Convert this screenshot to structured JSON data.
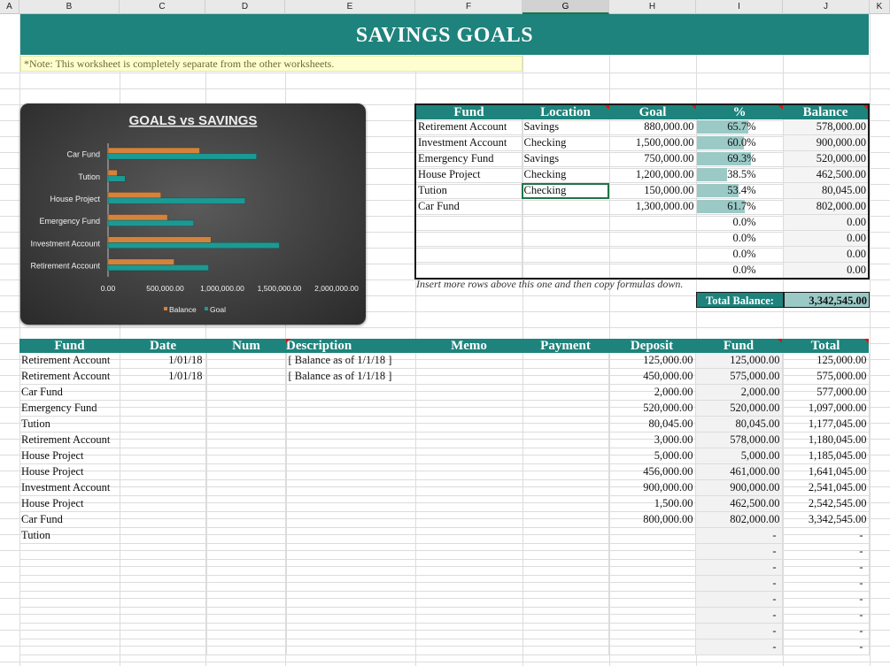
{
  "columns": [
    "A",
    "B",
    "C",
    "D",
    "E",
    "F",
    "G",
    "H",
    "I",
    "J",
    "K"
  ],
  "selected_column": "G",
  "title": "SAVINGS GOALS",
  "note": "*Note: This worksheet is completely separate from the other worksheets.",
  "chart_data": {
    "type": "bar",
    "orientation": "horizontal",
    "title": "GOALS vs SAVINGS",
    "categories": [
      "Car Fund",
      "Tution",
      "House Project",
      "Emergency Fund",
      "Investment Account",
      "Retirement Account"
    ],
    "series": [
      {
        "name": "Balance",
        "color": "#d4823c",
        "values": [
          802000,
          80045,
          462500,
          520000,
          900000,
          578000
        ]
      },
      {
        "name": "Goal",
        "color": "#1b9a93",
        "values": [
          1300000,
          150000,
          1200000,
          750000,
          1500000,
          880000
        ]
      }
    ],
    "xlim": [
      0,
      2000000
    ],
    "xticks": [
      "0.00",
      "500,000.00",
      "1,000,000.00",
      "1,500,000.00",
      "2,000,000.00"
    ],
    "legend": "bottom",
    "grid": false
  },
  "funds": {
    "headers": [
      "Fund",
      "Location",
      "Goal",
      "%",
      "Balance"
    ],
    "rows": [
      {
        "fund": "Retirement Account",
        "location": "Savings",
        "goal": "880,000.00",
        "pct": "65.7%",
        "pct_value": 0.657,
        "balance": "578,000.00"
      },
      {
        "fund": "Investment Account",
        "location": "Checking",
        "goal": "1,500,000.00",
        "pct": "60.0%",
        "pct_value": 0.6,
        "balance": "900,000.00"
      },
      {
        "fund": "Emergency Fund",
        "location": "Savings",
        "goal": "750,000.00",
        "pct": "69.3%",
        "pct_value": 0.693,
        "balance": "520,000.00"
      },
      {
        "fund": "House Project",
        "location": "Checking",
        "goal": "1,200,000.00",
        "pct": "38.5%",
        "pct_value": 0.385,
        "balance": "462,500.00"
      },
      {
        "fund": "Tution",
        "location": "Checking",
        "goal": "150,000.00",
        "pct": "53.4%",
        "pct_value": 0.534,
        "balance": "80,045.00"
      },
      {
        "fund": "Car Fund",
        "location": "",
        "goal": "1,300,000.00",
        "pct": "61.7%",
        "pct_value": 0.617,
        "balance": "802,000.00"
      },
      {
        "fund": "",
        "location": "",
        "goal": "",
        "pct": "0.0%",
        "pct_value": 0,
        "balance": "0.00"
      },
      {
        "fund": "",
        "location": "",
        "goal": "",
        "pct": "0.0%",
        "pct_value": 0,
        "balance": "0.00"
      },
      {
        "fund": "",
        "location": "",
        "goal": "",
        "pct": "0.0%",
        "pct_value": 0,
        "balance": "0.00"
      },
      {
        "fund": "",
        "location": "",
        "goal": "",
        "pct": "0.0%",
        "pct_value": 0,
        "balance": "0.00"
      }
    ],
    "insert_note": "Insert more rows above this one and then copy formulas down.",
    "total_label": "Total Balance:",
    "total_value": "3,342,545.00"
  },
  "ledger": {
    "headers": [
      "Fund",
      "Date",
      "Num",
      "Description",
      "Memo",
      "Payment",
      "Deposit",
      "Fund",
      "Total"
    ],
    "rows": [
      {
        "fund": "Retirement Account",
        "date": "1/01/18",
        "num": "",
        "desc": "[ Balance as of 1/1/18 ]",
        "memo": "",
        "payment": "",
        "deposit": "125,000.00",
        "fundbal": "125,000.00",
        "total": "125,000.00"
      },
      {
        "fund": "Retirement Account",
        "date": "1/01/18",
        "num": "",
        "desc": "[ Balance as of 1/1/18 ]",
        "memo": "",
        "payment": "",
        "deposit": "450,000.00",
        "fundbal": "575,000.00",
        "total": "575,000.00"
      },
      {
        "fund": "Car Fund",
        "date": "",
        "num": "",
        "desc": "",
        "memo": "",
        "payment": "",
        "deposit": "2,000.00",
        "fundbal": "2,000.00",
        "total": "577,000.00"
      },
      {
        "fund": "Emergency Fund",
        "date": "",
        "num": "",
        "desc": "",
        "memo": "",
        "payment": "",
        "deposit": "520,000.00",
        "fundbal": "520,000.00",
        "total": "1,097,000.00"
      },
      {
        "fund": "Tution",
        "date": "",
        "num": "",
        "desc": "",
        "memo": "",
        "payment": "",
        "deposit": "80,045.00",
        "fundbal": "80,045.00",
        "total": "1,177,045.00"
      },
      {
        "fund": "Retirement Account",
        "date": "",
        "num": "",
        "desc": "",
        "memo": "",
        "payment": "",
        "deposit": "3,000.00",
        "fundbal": "578,000.00",
        "total": "1,180,045.00"
      },
      {
        "fund": "House Project",
        "date": "",
        "num": "",
        "desc": "",
        "memo": "",
        "payment": "",
        "deposit": "5,000.00",
        "fundbal": "5,000.00",
        "total": "1,185,045.00"
      },
      {
        "fund": "House Project",
        "date": "",
        "num": "",
        "desc": "",
        "memo": "",
        "payment": "",
        "deposit": "456,000.00",
        "fundbal": "461,000.00",
        "total": "1,641,045.00"
      },
      {
        "fund": "Investment Account",
        "date": "",
        "num": "",
        "desc": "",
        "memo": "",
        "payment": "",
        "deposit": "900,000.00",
        "fundbal": "900,000.00",
        "total": "2,541,045.00"
      },
      {
        "fund": "House Project",
        "date": "",
        "num": "",
        "desc": "",
        "memo": "",
        "payment": "",
        "deposit": "1,500.00",
        "fundbal": "462,500.00",
        "total": "2,542,545.00"
      },
      {
        "fund": "Car Fund",
        "date": "",
        "num": "",
        "desc": "",
        "memo": "",
        "payment": "",
        "deposit": "800,000.00",
        "fundbal": "802,000.00",
        "total": "3,342,545.00"
      },
      {
        "fund": "Tution",
        "date": "",
        "num": "",
        "desc": "",
        "memo": "",
        "payment": "",
        "deposit": "",
        "fundbal": "-",
        "total": "-"
      },
      {
        "fund": "",
        "date": "",
        "num": "",
        "desc": "",
        "memo": "",
        "payment": "",
        "deposit": "",
        "fundbal": "-",
        "total": "-"
      },
      {
        "fund": "",
        "date": "",
        "num": "",
        "desc": "",
        "memo": "",
        "payment": "",
        "deposit": "",
        "fundbal": "-",
        "total": "-"
      },
      {
        "fund": "",
        "date": "",
        "num": "",
        "desc": "",
        "memo": "",
        "payment": "",
        "deposit": "",
        "fundbal": "-",
        "total": "-"
      },
      {
        "fund": "",
        "date": "",
        "num": "",
        "desc": "",
        "memo": "",
        "payment": "",
        "deposit": "",
        "fundbal": "-",
        "total": "-"
      },
      {
        "fund": "",
        "date": "",
        "num": "",
        "desc": "",
        "memo": "",
        "payment": "",
        "deposit": "",
        "fundbal": "-",
        "total": "-"
      },
      {
        "fund": "",
        "date": "",
        "num": "",
        "desc": "",
        "memo": "",
        "payment": "",
        "deposit": "",
        "fundbal": "-",
        "total": "-"
      },
      {
        "fund": "",
        "date": "",
        "num": "",
        "desc": "",
        "memo": "",
        "payment": "",
        "deposit": "",
        "fundbal": "-",
        "total": "-"
      }
    ]
  },
  "colors": {
    "teal": "#1e837c",
    "bar_teal": "#9ac9c6",
    "note_bg": "#fefed0",
    "selection": "#217346"
  }
}
